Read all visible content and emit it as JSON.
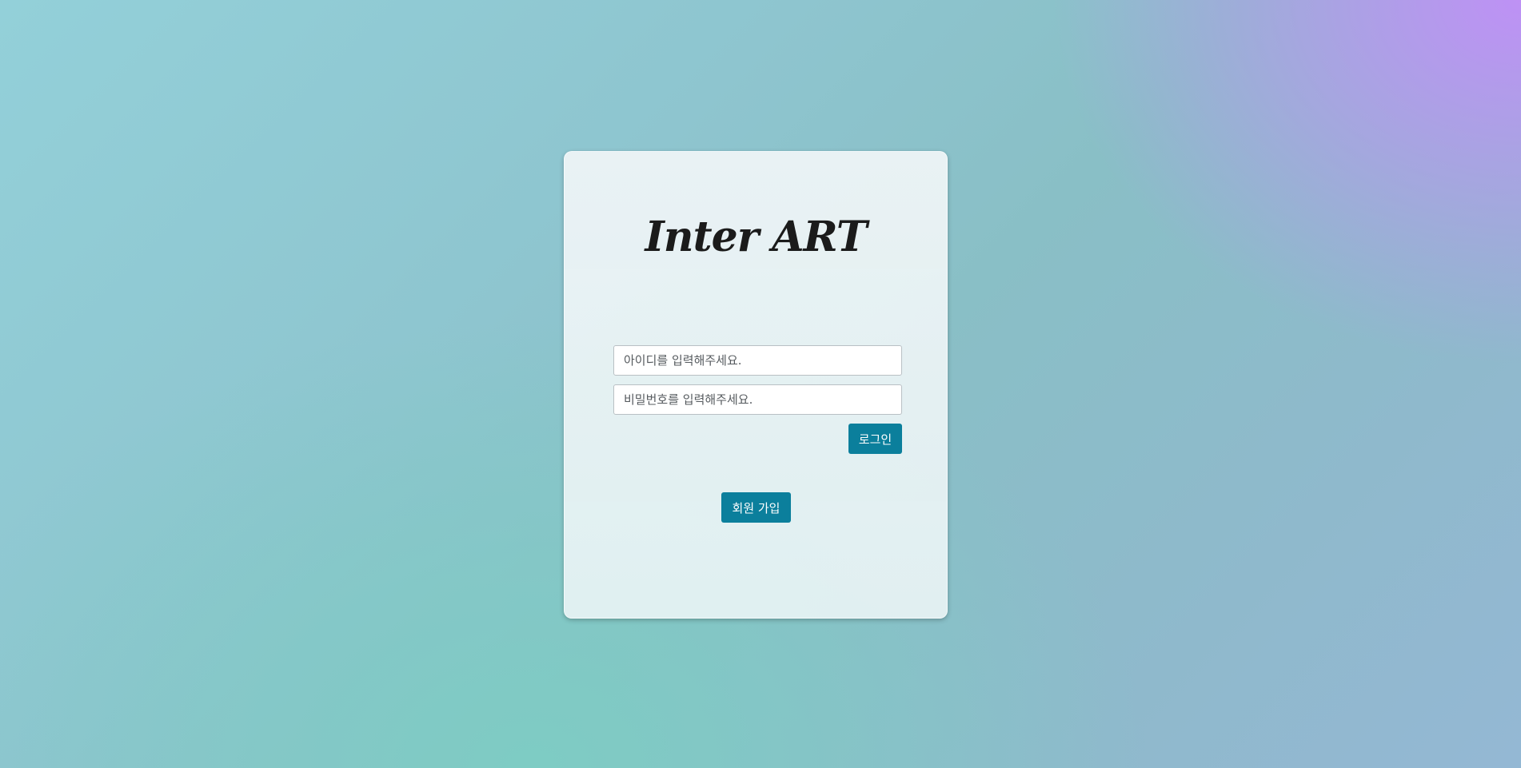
{
  "brand": {
    "title": "Inter ART"
  },
  "login_form": {
    "username_placeholder": "아이디를 입력해주세요.",
    "password_placeholder": "비밀번호를 입력해주세요.",
    "login_label": "로그인"
  },
  "signup": {
    "label": "회원 가입"
  },
  "colors": {
    "button": "#0b7f9c",
    "title": "#1b1b1b",
    "card": "#eaf3f4"
  }
}
